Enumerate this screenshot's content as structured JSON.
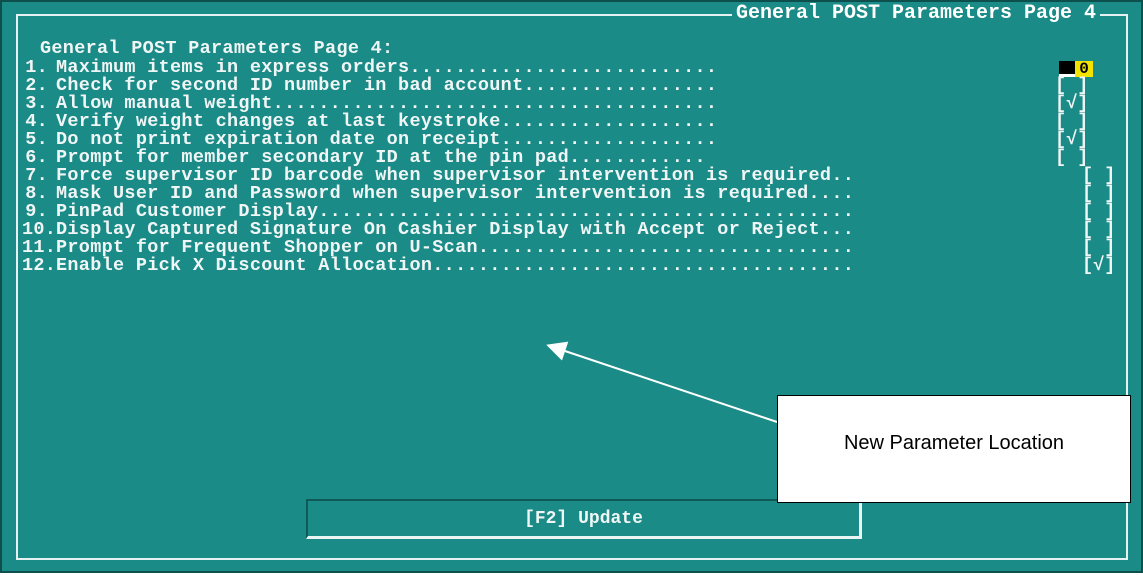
{
  "window": {
    "title": "General POST Parameters Page 4"
  },
  "heading": "General POST Parameters Page 4:",
  "parameters": [
    {
      "num": "1.",
      "label": "Maximum items in express orders...........................",
      "value": "0"
    },
    {
      "num": "2.",
      "label": "Check for second ID number in bad account.................",
      "value": "[ ]"
    },
    {
      "num": "3.",
      "label": "Allow manual weight.......................................",
      "value": "[√]"
    },
    {
      "num": "4.",
      "label": "Verify weight changes at last keystroke...................",
      "value": "[ ]"
    },
    {
      "num": "5.",
      "label": "Do not print expiration date on receipt...................",
      "value": "[√]"
    },
    {
      "num": "6.",
      "label": "Prompt for member secondary ID at the pin pad............",
      "value": "[ ]"
    },
    {
      "num": "7.",
      "label": "Force supervisor ID barcode when supervisor intervention is required..",
      "value": "[ ]"
    },
    {
      "num": "8.",
      "label": "Mask User ID and Password when supervisor intervention is required....",
      "value": "[ ]"
    },
    {
      "num": "9.",
      "label": "PinPad Customer Display...............................................",
      "value": "[ ]"
    },
    {
      "num": "10.",
      "label": "Display Captured Signature On Cashier Display with Accept or Reject...",
      "value": "[ ]"
    },
    {
      "num": "11.",
      "label": "Prompt for Frequent Shopper on U-Scan.................................",
      "value": "[ ]"
    },
    {
      "num": "12.",
      "label": "Enable Pick X Discount Allocation.....................................",
      "value": "[√]"
    }
  ],
  "update_button": "[F2] Update",
  "callout": "New Parameter Location",
  "colors": {
    "background": "#1a8b87",
    "text": "#f0f6f6",
    "field_highlight": "#f2e400"
  }
}
